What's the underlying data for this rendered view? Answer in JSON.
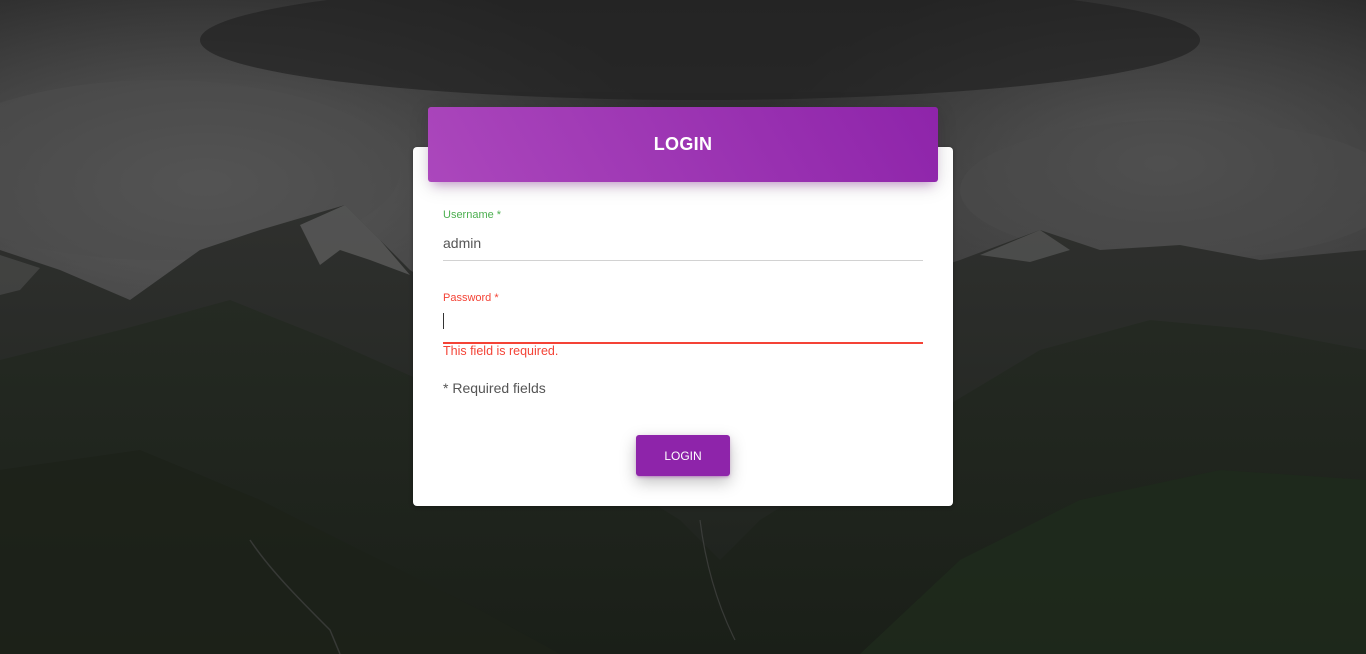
{
  "background": {
    "description_icon": "mountain-landscape-background"
  },
  "login_card": {
    "title": "LOGIN",
    "header_gradient": [
      "#ab47bc",
      "#8e24aa"
    ],
    "username": {
      "label": "Username *",
      "value": "admin",
      "state": "valid",
      "label_color": "#4caf50"
    },
    "password": {
      "label": "Password *",
      "value": "",
      "state": "error",
      "label_color": "#f44336",
      "error_text": "This field is required."
    },
    "required_note": "* Required fields",
    "submit_label": "LOGIN",
    "button_color": "#8e24aa"
  }
}
